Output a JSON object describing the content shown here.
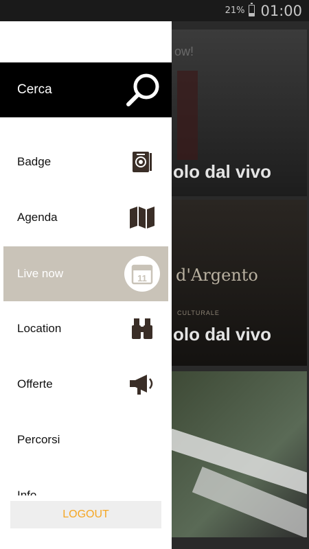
{
  "status_bar": {
    "battery": "21%",
    "clock": "01:00"
  },
  "background": {
    "card1": {
      "top_text": "ow!",
      "overlay_title": "olo dal vivo"
    },
    "card2": {
      "banner": "d'Argento",
      "sub": "CULTURALE",
      "overlay_title": "olo dal vivo"
    },
    "card3": {}
  },
  "drawer": {
    "search": {
      "label": "Cerca",
      "icon": "search-icon"
    },
    "items": [
      {
        "label": "Badge",
        "icon": "badge-icon",
        "active": false
      },
      {
        "label": "Agenda",
        "icon": "map-icon",
        "active": false
      },
      {
        "label": "Live now",
        "icon": "calendar-icon",
        "active": true,
        "calendar_day": "11"
      },
      {
        "label": "Location",
        "icon": "binoculars-icon",
        "active": false
      },
      {
        "label": "Offerte",
        "icon": "megaphone-icon",
        "active": false
      },
      {
        "label": "Percorsi",
        "icon": "",
        "active": false
      },
      {
        "label": "Info",
        "icon": "",
        "active": false
      }
    ],
    "logout_label": "LOGOUT"
  },
  "colors": {
    "accent": "#f5a623",
    "active_bg": "#c9c3b8",
    "icon": "#3a2e27"
  }
}
